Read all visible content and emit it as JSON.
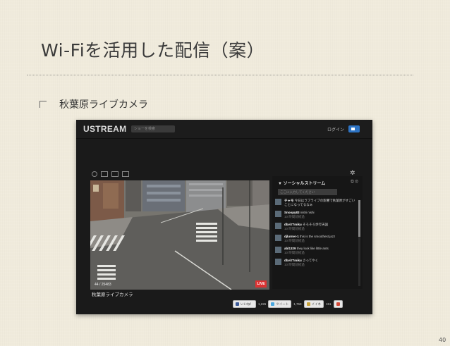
{
  "slide": {
    "title": "Wi-Fiを活用した配信（案）",
    "bullet": "秋葉原ライブカメラ",
    "page_number": "40"
  },
  "ustream": {
    "logo": "USTREAM",
    "search_placeholder": "ショーを検索",
    "login": "ログイン",
    "viewers": "44 / 25483",
    "live_badge": "LIVE",
    "channel_title": "秋葉原ライブカメラ",
    "social": {
      "heading": "▼ ソーシャルストリーム",
      "input_placeholder": "ここに入力してください",
      "feed": [
        {
          "name": "チャモ",
          "text": "今日はラブライブの影響で秋葉原がすごいことになってるなぁ",
          "time": ""
        },
        {
          "name": "Snoopy83",
          "text": "nishi nishi",
          "time": "10 時間前経過"
        },
        {
          "name": "dbvi77miku",
          "text": "そろそろ歩行天国",
          "time": "10 時間前経過"
        },
        {
          "name": "djlurner-1",
          "text": "this is the smoothest jazz",
          "time": "10 時間前経過"
        },
        {
          "name": "abl1329",
          "text": "they look like little ants",
          "time": "10 時間前経過"
        },
        {
          "name": "dbvi77miku",
          "text": "さってやく",
          "time": "10 時間前経過"
        }
      ]
    },
    "share": {
      "like": "いいね！",
      "like_count": "1,226",
      "tweet": "ツイート",
      "tweet_count": "1,763",
      "iine": "イイネ",
      "iine_count": "151"
    },
    "colors": {
      "brand_blue": "#2e74c4",
      "live_red": "#dd3333",
      "chrome_dark": "#1a1a1a"
    }
  }
}
